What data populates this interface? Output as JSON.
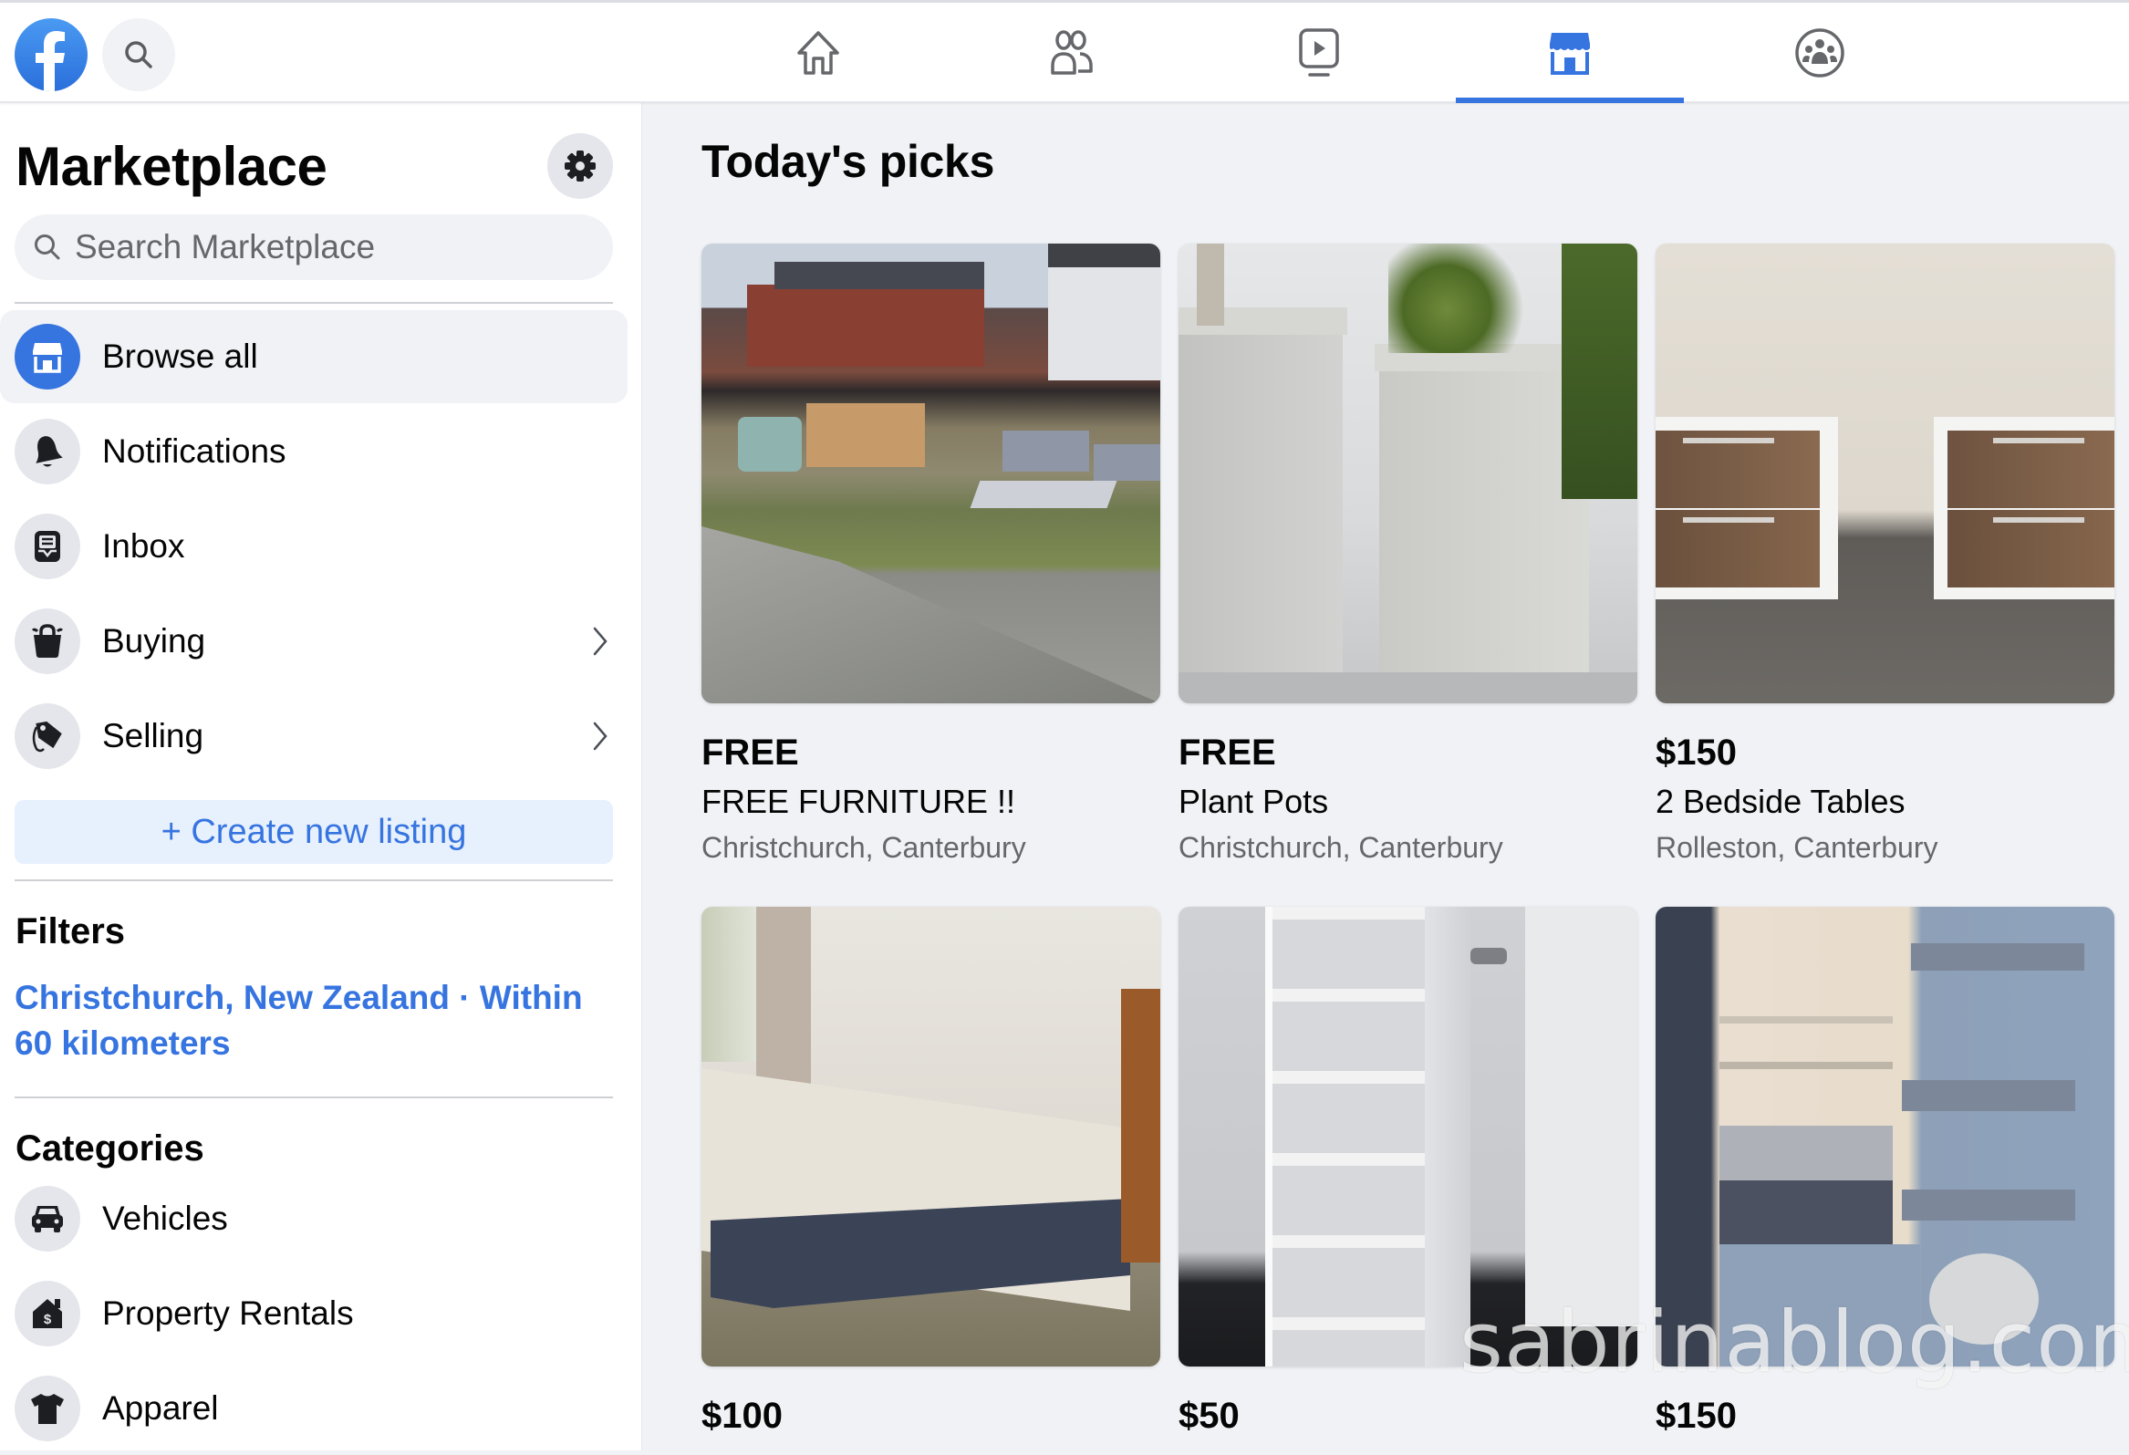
{
  "header": {
    "logo": "facebook-logo",
    "search_icon": "search-icon",
    "nav_tabs": [
      {
        "name": "home",
        "icon": "home-icon",
        "active": false
      },
      {
        "name": "friends",
        "icon": "friends-icon",
        "active": false
      },
      {
        "name": "watch",
        "icon": "video-icon",
        "active": false
      },
      {
        "name": "marketplace",
        "icon": "marketplace-icon",
        "active": true
      },
      {
        "name": "groups",
        "icon": "groups-icon",
        "active": false
      }
    ],
    "accent_color": "#3674e0"
  },
  "sidebar": {
    "title": "Marketplace",
    "settings_icon": "gear-icon",
    "search": {
      "placeholder": "Search Marketplace",
      "value": ""
    },
    "nav_items": [
      {
        "label": "Browse all",
        "icon": "storefront-icon",
        "active": true,
        "has_chevron": false
      },
      {
        "label": "Notifications",
        "icon": "bell-icon",
        "active": false,
        "has_chevron": false
      },
      {
        "label": "Inbox",
        "icon": "inbox-icon",
        "active": false,
        "has_chevron": false
      },
      {
        "label": "Buying",
        "icon": "shopping-bag-icon",
        "active": false,
        "has_chevron": true
      },
      {
        "label": "Selling",
        "icon": "price-tag-icon",
        "active": false,
        "has_chevron": true
      }
    ],
    "create_listing_label": "+ Create new listing",
    "filters": {
      "heading": "Filters",
      "location_link": "Christchurch, New Zealand · Within 60 kilometers"
    },
    "categories": {
      "heading": "Categories",
      "items": [
        {
          "label": "Vehicles",
          "icon": "car-icon"
        },
        {
          "label": "Property Rentals",
          "icon": "house-dollar-icon"
        },
        {
          "label": "Apparel",
          "icon": "tshirt-icon"
        }
      ]
    }
  },
  "main": {
    "section_title": "Today's picks",
    "listings": [
      {
        "price": "FREE",
        "title": "FREE FURNITURE !!",
        "location": "Christchurch, Canterbury",
        "photo": "outdoor chairs on a grass verge"
      },
      {
        "price": "FREE",
        "title": "Plant Pots",
        "location": "Christchurch, Canterbury",
        "photo": "two concrete planters"
      },
      {
        "price": "$150",
        "title": "2 Bedside Tables",
        "location": "Rolleston, Canterbury",
        "photo": "two white and wood bedside tables"
      },
      {
        "price": "$100",
        "title": "",
        "location": "",
        "photo": "bed with white mattress"
      },
      {
        "price": "$50",
        "title": "",
        "location": "",
        "photo": "white plastic drawer tower"
      },
      {
        "price": "$150",
        "title": "",
        "location": "",
        "photo": "open fridge freezer"
      }
    ]
  },
  "watermark": "sabrinablog.com"
}
